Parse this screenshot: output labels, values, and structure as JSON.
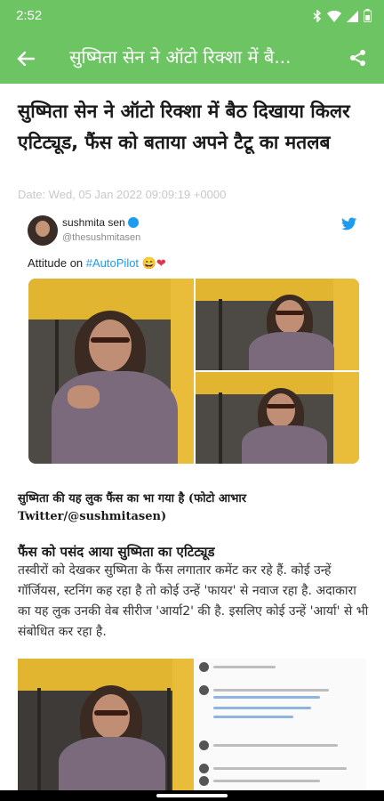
{
  "status_bar": {
    "time": "2:52",
    "icons": [
      "bluetooth-icon",
      "wifi-icon",
      "signal-icon",
      "battery-icon"
    ]
  },
  "app_bar": {
    "title": "सुष्मिता सेन ने ऑटो रिक्शा में बै...",
    "back_icon": "back-arrow-icon",
    "share_icon": "share-icon",
    "color": "#6cc462"
  },
  "article": {
    "headline": "सुष्मिता सेन ने ऑटो रिक्शा में बैठ दिखाया किलर एटिट्यूड, फैंस को बताया अपने टैटू का मतलब",
    "date": "Date: Wed, 05 Jan 2022 09:09:19 +0000",
    "caption": "सुष्मिता की यह लुक फैंस का भा गया है (फोटो आभार Twitter/@sushmitasen)",
    "subheading": "फैंस को पसंद आया सुष्मिता का एटिट्यूड",
    "paragraph": "तस्वीरों को देखकर सुष्मिता के फैंस लगातार कमेंट कर रहे हैं. कोई उन्हें गॉर्जियस, स्टनिंग कह रहा है तो कोई उन्हें 'फायर' से नवाज रहा है. अदाकारा का यह लुक उनकी वेब सीरीज 'आर्या2' की है. इसलिए कोई उन्हें 'आर्या' से भी संबोधित कर रहा है."
  },
  "tweet": {
    "name": "sushmita sen",
    "handle": "@thesushmitasen",
    "text_prefix": "Attitude on ",
    "hashtag": "#AutoPilot",
    "emojis": "😄❤",
    "twitter_color": "#1d9bf0"
  }
}
